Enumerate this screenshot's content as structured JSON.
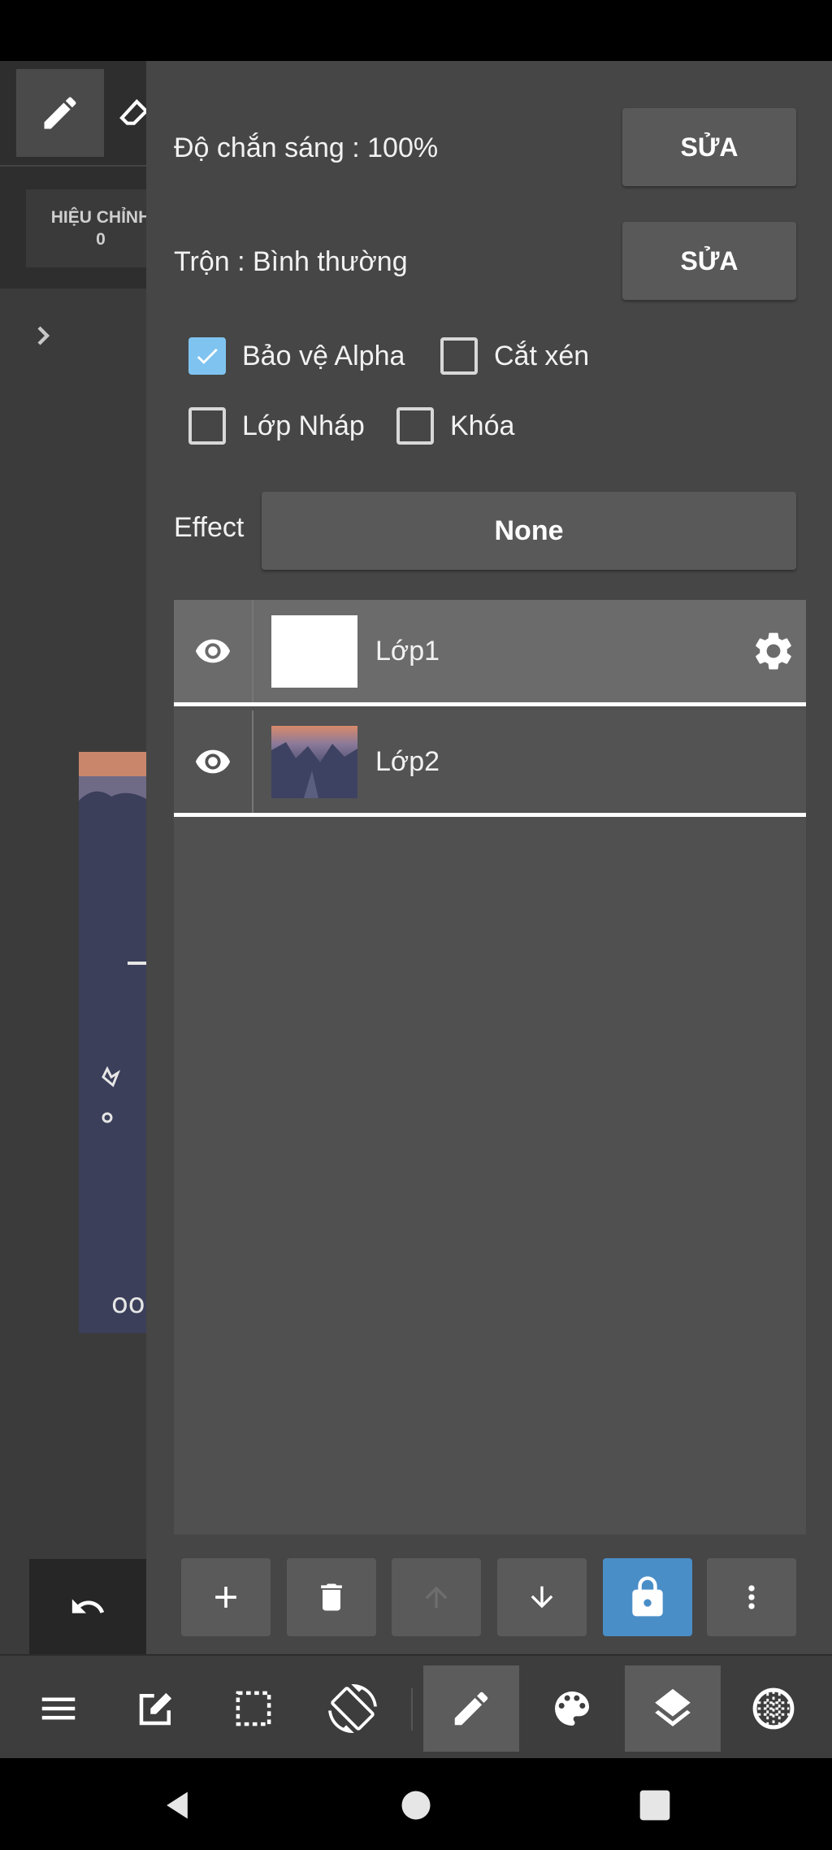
{
  "left_pane": {
    "adjust_label": "HIỆU CHỈNH",
    "adjust_value": "0"
  },
  "properties": {
    "opacity_label": "Độ chắn sáng : 100%",
    "blend_label": "Trộn : Bình thường",
    "edit_button_label": "SỬA"
  },
  "options": {
    "protect_alpha": {
      "label": "Bảo vệ Alpha",
      "checked": true
    },
    "clipping": {
      "label": "Cắt xén",
      "checked": false
    },
    "draft_layer": {
      "label": "Lớp Nháp",
      "checked": false
    },
    "lock": {
      "label": "Khóa",
      "checked": false
    }
  },
  "effect": {
    "label": "Effect",
    "value": "None"
  },
  "layers": [
    {
      "name": "Lớp1",
      "visible": true,
      "selected": true
    },
    {
      "name": "Lớp2",
      "visible": true,
      "selected": false
    }
  ],
  "layer_actions": [
    "add-icon",
    "delete-icon",
    "move-up-icon",
    "move-down-icon",
    "lock-icon",
    "more-icon"
  ],
  "bottom_toolbar": [
    "menu-icon",
    "edit-icon",
    "selection-icon",
    "rotate-icon",
    "brush-icon",
    "palette-icon",
    "layers-icon",
    "globe-icon"
  ],
  "colors": {
    "panel_bg": "#464646",
    "button_bg": "#595959",
    "accent_blue": "#4a8ec8",
    "checkbox_checked": "#7fc4f0"
  }
}
